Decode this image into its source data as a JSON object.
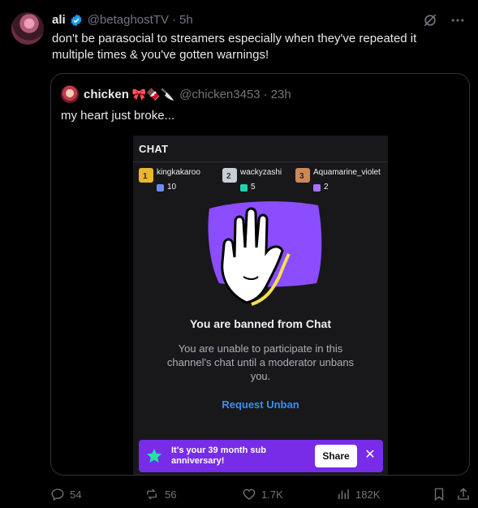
{
  "post": {
    "author_name": "ali",
    "handle": "@betaghostTV",
    "separator": "·",
    "time": "5h",
    "text": "don't be parasocial to streamers especially when they've repeated it multiple times & you've gotten warnings!"
  },
  "quoted": {
    "author_name": "chicken",
    "emojis": "🎀🍫🔪",
    "handle": "@chicken3453",
    "separator": "·",
    "time": "23h",
    "text": "my heart just broke...",
    "screenshot": {
      "chat_title": "CHAT",
      "gifters": [
        {
          "name": "kingkakaroo",
          "count": "10",
          "rank": "1"
        },
        {
          "name": "wackyzashi",
          "count": "5",
          "rank": "2"
        },
        {
          "name": "Aquamarine_violet",
          "count": "2",
          "rank": "3"
        }
      ],
      "ban_title": "You are banned from Chat",
      "ban_desc": "You are unable to participate in this channel's chat until a moderator unbans you.",
      "request_unban": "Request Unban",
      "anniversary_msg": "It's your 39 month sub anniversary!",
      "share_label": "Share",
      "close_symbol": "✕"
    }
  },
  "actions": {
    "replies": "54",
    "reposts": "56",
    "likes": "1.7K",
    "views": "182K"
  },
  "icons": {
    "verified": "verified-badge-icon",
    "grok": "grok-icon",
    "more": "more-icon",
    "reply": "reply-icon",
    "repost": "repost-icon",
    "like": "heart-icon",
    "views": "views-icon",
    "bookmark": "bookmark-icon",
    "share": "share-icon"
  },
  "colors": {
    "twitch_purple": "#772ce8",
    "link_blue": "#3a8ef0",
    "verified_blue": "#1d9bf0"
  }
}
